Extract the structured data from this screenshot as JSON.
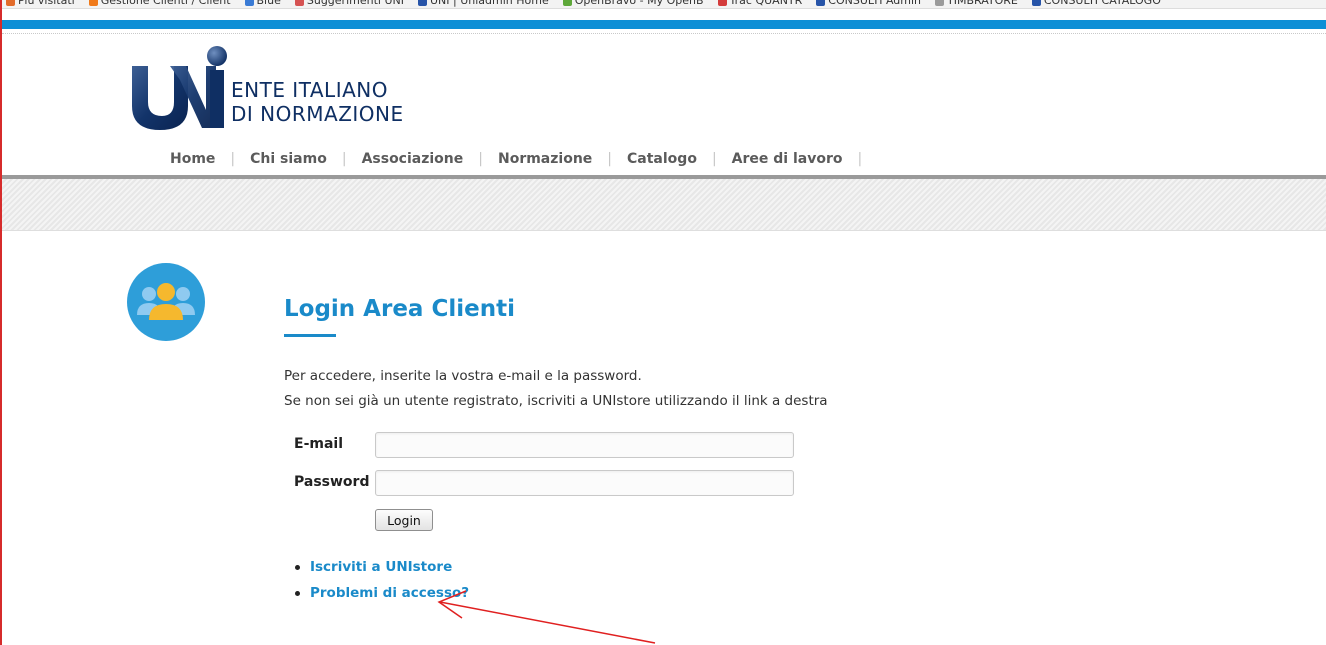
{
  "brand": {
    "line1": "ENTE ITALIANO",
    "line2": "DI NORMAZIONE",
    "logo_color": "#0f2f63"
  },
  "bookmarks": [
    {
      "label": "Più visitati",
      "color": "#e26b2a"
    },
    {
      "label": "Gestione Clienti / Client",
      "color": "#f07a1a"
    },
    {
      "label": "Blue",
      "color": "#3a7bd5"
    },
    {
      "label": "Suggerimenti UNI",
      "color": "#d65353"
    },
    {
      "label": "UNI | Uniadmin Home",
      "color": "#2754a8"
    },
    {
      "label": "OpenBravo - My OpenB",
      "color": "#5ea83a"
    },
    {
      "label": "Trac QUANTR",
      "color": "#d43b3b"
    },
    {
      "label": "CONSULTI Admin",
      "color": "#2754a8"
    },
    {
      "label": "TIMBRATORE",
      "color": "#9b9b9b"
    },
    {
      "label": "CONSULTI CATALOGO",
      "color": "#2754a8"
    }
  ],
  "nav": {
    "items": [
      "Home",
      "Chi siamo",
      "Associazione",
      "Normazione",
      "Catalogo",
      "Aree di lavoro"
    ]
  },
  "login": {
    "title": "Login Area Clienti",
    "intro_line1": "Per accedere, inserite la vostra e-mail e la password.",
    "intro_line2": "Se non sei già un utente registrato, iscriviti a UNIstore utilizzando il link a destra",
    "email_label": "E-mail",
    "email_value": "",
    "password_label": "Password",
    "password_value": "",
    "button_label": "Login",
    "links": [
      "Iscriviti a UNIstore",
      "Problemi di accesso?"
    ]
  },
  "colors": {
    "accent": "#1a8ac9",
    "topbar": "#0e8fd6",
    "annotation": "#e02020",
    "avatar_bg": "#2e9ed9",
    "avatar_front": "#f5b82e"
  }
}
